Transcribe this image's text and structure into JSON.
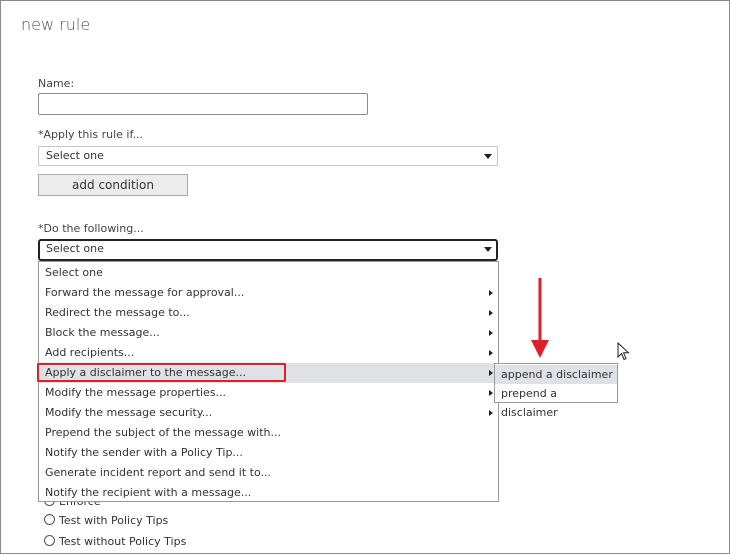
{
  "dialog": {
    "title": "new rule"
  },
  "name_field": {
    "label": "Name:",
    "value": ""
  },
  "condition": {
    "label": "*Apply this rule if...",
    "select_value": "Select one",
    "add_button": "add condition"
  },
  "action": {
    "label": "*Do the following...",
    "select_value": "Select one",
    "options": [
      "Select one",
      "Forward the message for approval...",
      "Redirect the message to...",
      "Block the message...",
      "Add recipients...",
      "Apply a disclaimer to the message...",
      "Modify the message properties...",
      "Modify the message security...",
      "Prepend the subject of the message with...",
      "Notify the sender with a Policy Tip...",
      "Generate incident report and send it to...",
      "Notify the recipient with a message..."
    ],
    "highlighted_option": "Apply a disclaimer to the message...",
    "submenu": [
      "append a disclaimer",
      "prepend a disclaimer"
    ]
  },
  "mode": {
    "options": [
      "Enforce",
      "Test with Policy Tips",
      "Test without Policy Tips"
    ]
  },
  "colors": {
    "annotation_red": "#e11f26",
    "hover_bg": "#dfe1e6",
    "border": "#9a9a9a"
  }
}
